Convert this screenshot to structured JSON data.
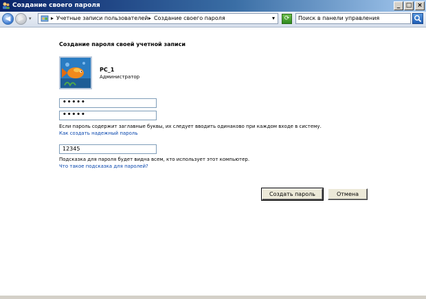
{
  "window": {
    "title": "Создание своего пароля",
    "minimize": "_",
    "maximize": "□",
    "close": "×"
  },
  "addressbar": {
    "crumbs": [
      "Учетные записи пользователей",
      "Создание своего пароля"
    ],
    "separator": "▸",
    "dropdown": "▾",
    "search_placeholder": "Поиск в панели управления"
  },
  "main": {
    "heading": "Создание пароля своей учетной записи",
    "user_name": "PC_1",
    "user_role": "Администратор",
    "password_value": "•••••",
    "confirm_value": "•••••",
    "case_note": "Если пароль содержит заглавные буквы, их следует вводить одинаково при каждом входе в систему.",
    "strong_password_link": "Как создать надежный пароль",
    "hint_value": "12345",
    "hint_note": "Подсказка для пароля будет видна всем, кто использует этот компьютер.",
    "hint_link": "Что такое подсказка для паролей?",
    "create_button": "Создать пароль",
    "cancel_button": "Отмена"
  },
  "colors": {
    "title_bar_start": "#0a246a",
    "title_bar_end": "#a6caf0",
    "link": "#0645ad",
    "button_face": "#ece9d8"
  }
}
